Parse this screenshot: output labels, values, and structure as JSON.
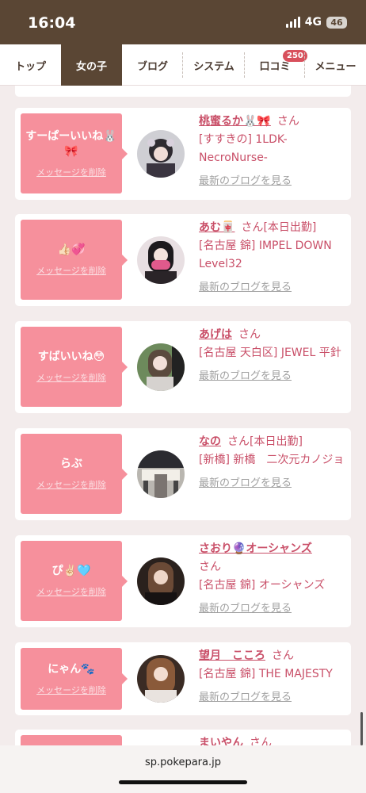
{
  "status": {
    "time": "16:04",
    "network": "4G",
    "battery": "46"
  },
  "nav": {
    "tabs": [
      {
        "label": "トップ",
        "active": false
      },
      {
        "label": "女の子",
        "active": true
      },
      {
        "label": "ブログ",
        "active": false
      },
      {
        "label": "システム",
        "active": false
      },
      {
        "label": "口コミ",
        "active": false,
        "badge": "250"
      },
      {
        "label": "メニュー",
        "active": false
      }
    ]
  },
  "cards": [
    {
      "message": "すーぱーいいね🐰🎀",
      "delete_label": "メッセージを削除",
      "name": "桃蜜るか🐰🎀",
      "honorific": "さん",
      "tag": "",
      "shop": "[すすきの] 1LDK-NecroNurse-",
      "blog_link": "最新のブログを見る"
    },
    {
      "message": "👍🏻💞",
      "delete_label": "メッセージを削除",
      "name": "あむ🀄",
      "honorific": "さん",
      "tag": "[本日出勤]",
      "shop": "[名古屋 錦] IMPEL DOWN Level32",
      "blog_link": "最新のブログを見る"
    },
    {
      "message": "すばいいね😳",
      "delete_label": "メッセージを削除",
      "name": "あげは",
      "honorific": "さん",
      "tag": "",
      "shop": "[名古屋 天白区] JEWEL 平針",
      "blog_link": "最新のブログを見る"
    },
    {
      "message": "らぶ",
      "delete_label": "メッセージを削除",
      "name": "なの",
      "honorific": "さん",
      "tag": "[本日出勤]",
      "shop": "[新橋] 新橋　二次元カノジョ",
      "blog_link": "最新のブログを見る"
    },
    {
      "message": "ぴ✌🏻🩵",
      "delete_label": "メッセージを削除",
      "name": "さおり🔮オーシャンズ",
      "honorific": "さん",
      "tag": "",
      "shop": "[名古屋 錦] オーシャンズ",
      "blog_link": "最新のブログを見る"
    },
    {
      "message": "にゃん🐾",
      "delete_label": "メッセージを削除",
      "name": "望月　こころ",
      "honorific": "さん",
      "tag": "",
      "shop": "[名古屋 錦] THE MAJESTY",
      "blog_link": "最新のブログを見る"
    },
    {
      "message": "",
      "delete_label": "",
      "name": "まいやん",
      "honorific": "さん",
      "tag": "",
      "shop": "",
      "blog_link": ""
    }
  ],
  "browser": {
    "url": "sp.pokepara.jp"
  },
  "colors": {
    "brand_brown": "#5a4634",
    "bubble_pink": "#f6909c",
    "name_pink": "#c94f68",
    "badge_red": "#d8505c"
  }
}
